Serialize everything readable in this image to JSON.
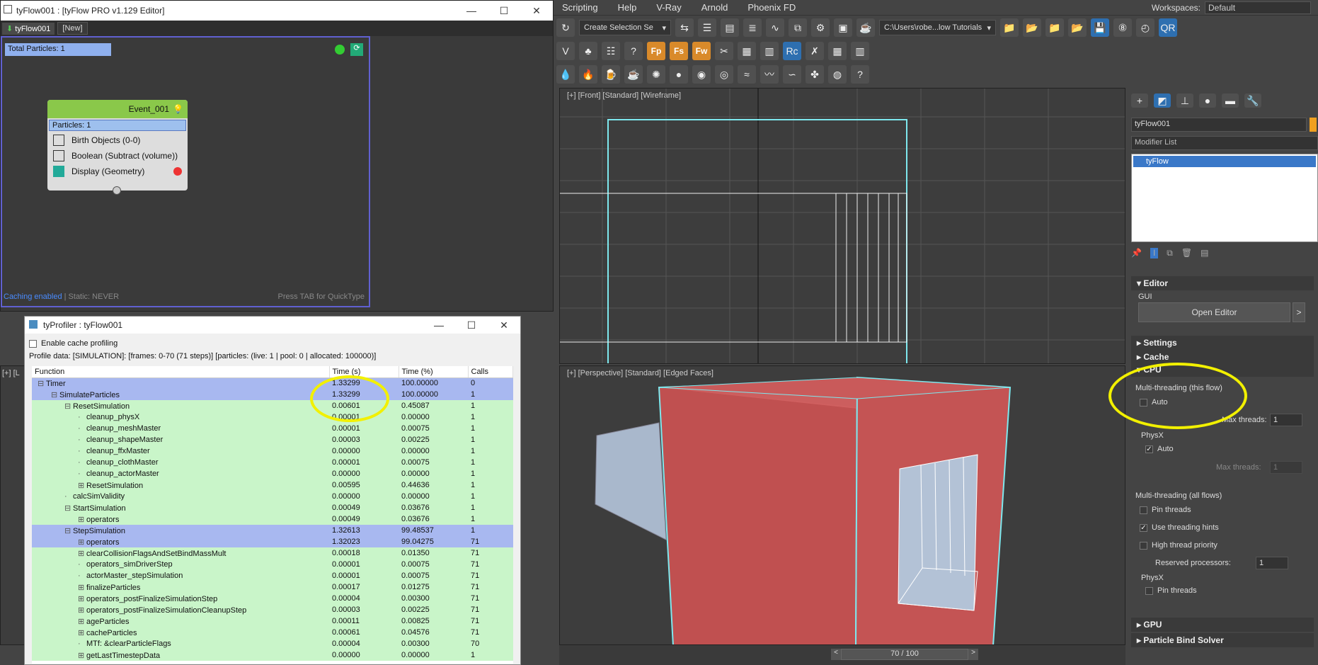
{
  "max": {
    "menu": [
      "Scripting",
      "Help",
      "V-Ray",
      "Arnold",
      "Phoenix FD"
    ],
    "workspaces_label": "Workspaces:",
    "workspace": "Default",
    "selection_set": "Create Selection Se",
    "path": "C:\\Users\\robe...low Tutorials",
    "toolbar2_icons": [
      "Fp",
      "Fs",
      "Fw",
      "Rc"
    ],
    "frame": "70 / 100"
  },
  "viewports": {
    "front": "[+] [Front] [Standard] [Wireframe]",
    "persp": "[+] [Perspective] [Standard] [Edged Faces]",
    "left_label": "[+] [L"
  },
  "cmd": {
    "object_name": "tyFlow001",
    "modifier_list": "Modifier List",
    "stack_item": "tyFlow",
    "editor": "Editor",
    "gui": "GUI",
    "open_editor": "Open Editor",
    "arrow": ">",
    "settings": "Settings",
    "cache": "Cache",
    "cpu": "CPU",
    "mt_this": "Multi-threading (this flow)",
    "auto": "Auto",
    "max_threads": "Max threads:",
    "max_threads_val": "1",
    "physx": "PhysX",
    "physx_auto": "Auto",
    "physx_max": "Max threads:",
    "physx_max_val": "1",
    "mt_all": "Multi-threading (all flows)",
    "pin": "Pin threads",
    "hints": "Use threading hints",
    "priority": "High thread priority",
    "reserved": "Reserved processors:",
    "reserved_val": "1",
    "physx2": "PhysX",
    "pin2": "Pin threads",
    "gpu": "GPU",
    "pbs": "Particle Bind Solver"
  },
  "ty": {
    "title": "tyFlow001 : [tyFlow PRO v1.129 Editor]",
    "tab1": "tyFlow001",
    "tab2": "[New]",
    "total": "Total Particles: 1",
    "event": "Event_001",
    "particles": "Particles: 1",
    "ops": [
      "Birth Objects (0-0)",
      "Boolean (Subtract (volume))",
      "Display (Geometry)"
    ],
    "status": "Caching enabled",
    "static": " | Static: NEVER",
    "hint": "Press TAB for QuickType"
  },
  "prof": {
    "title": "tyProfiler : tyFlow001",
    "cache": "Enable cache profiling",
    "data": "Profile data:   [SIMULATION]: [frames: 0-70 (71 steps)] [particles: (live: 1 | pool: 0 | allocated: 100000)]",
    "cols": [
      "Function",
      "Time (s)",
      "Time (%)",
      "Calls"
    ],
    "rows": [
      {
        "f": "Timer",
        "t": "1.33299",
        "p": "100.00000",
        "c": "0",
        "ind": 0,
        "st": "s",
        "ex": "-"
      },
      {
        "f": "SimulateParticles",
        "t": "1.33299",
        "p": "100.00000",
        "c": "1",
        "ind": 1,
        "st": "s",
        "ex": "-"
      },
      {
        "f": "ResetSimulation",
        "t": "0.00601",
        "p": "0.45087",
        "c": "1",
        "ind": 2,
        "st": "g",
        "ex": "-"
      },
      {
        "f": "cleanup_physX",
        "t": "0.00001",
        "p": "0.00000",
        "c": "1",
        "ind": 3,
        "st": "g",
        "ex": ""
      },
      {
        "f": "cleanup_meshMaster",
        "t": "0.00001",
        "p": "0.00075",
        "c": "1",
        "ind": 3,
        "st": "g",
        "ex": ""
      },
      {
        "f": "cleanup_shapeMaster",
        "t": "0.00003",
        "p": "0.00225",
        "c": "1",
        "ind": 3,
        "st": "g",
        "ex": ""
      },
      {
        "f": "cleanup_ffxMaster",
        "t": "0.00000",
        "p": "0.00000",
        "c": "1",
        "ind": 3,
        "st": "g",
        "ex": ""
      },
      {
        "f": "cleanup_clothMaster",
        "t": "0.00001",
        "p": "0.00075",
        "c": "1",
        "ind": 3,
        "st": "g",
        "ex": ""
      },
      {
        "f": "cleanup_actorMaster",
        "t": "0.00000",
        "p": "0.00000",
        "c": "1",
        "ind": 3,
        "st": "g",
        "ex": ""
      },
      {
        "f": "ResetSimulation",
        "t": "0.00595",
        "p": "0.44636",
        "c": "1",
        "ind": 3,
        "st": "g",
        "ex": "+"
      },
      {
        "f": "calcSimValidity",
        "t": "0.00000",
        "p": "0.00000",
        "c": "1",
        "ind": 2,
        "st": "g",
        "ex": ""
      },
      {
        "f": "StartSimulation",
        "t": "0.00049",
        "p": "0.03676",
        "c": "1",
        "ind": 2,
        "st": "g",
        "ex": "-"
      },
      {
        "f": "operators",
        "t": "0.00049",
        "p": "0.03676",
        "c": "1",
        "ind": 3,
        "st": "g",
        "ex": "+"
      },
      {
        "f": "StepSimulation",
        "t": "1.32613",
        "p": "99.48537",
        "c": "1",
        "ind": 2,
        "st": "s",
        "ex": "-"
      },
      {
        "f": "operators",
        "t": "1.32023",
        "p": "99.04275",
        "c": "71",
        "ind": 3,
        "st": "s",
        "ex": "+"
      },
      {
        "f": "clearCollisionFlagsAndSetBindMassMult",
        "t": "0.00018",
        "p": "0.01350",
        "c": "71",
        "ind": 3,
        "st": "g",
        "ex": "+"
      },
      {
        "f": "operators_simDriverStep",
        "t": "0.00001",
        "p": "0.00075",
        "c": "71",
        "ind": 3,
        "st": "g",
        "ex": ""
      },
      {
        "f": "actorMaster_stepSimulation",
        "t": "0.00001",
        "p": "0.00075",
        "c": "71",
        "ind": 3,
        "st": "g",
        "ex": ""
      },
      {
        "f": "finalizeParticles",
        "t": "0.00017",
        "p": "0.01275",
        "c": "71",
        "ind": 3,
        "st": "g",
        "ex": "+"
      },
      {
        "f": "operators_postFinalizeSimulationStep",
        "t": "0.00004",
        "p": "0.00300",
        "c": "71",
        "ind": 3,
        "st": "g",
        "ex": "+"
      },
      {
        "f": "operators_postFinalizeSimulationCleanupStep",
        "t": "0.00003",
        "p": "0.00225",
        "c": "71",
        "ind": 3,
        "st": "g",
        "ex": "+"
      },
      {
        "f": "ageParticles",
        "t": "0.00011",
        "p": "0.00825",
        "c": "71",
        "ind": 3,
        "st": "g",
        "ex": "+"
      },
      {
        "f": "cacheParticles",
        "t": "0.00061",
        "p": "0.04576",
        "c": "71",
        "ind": 3,
        "st": "g",
        "ex": "+"
      },
      {
        "f": "MTf: &clearParticleFlags",
        "t": "0.00004",
        "p": "0.00300",
        "c": "70",
        "ind": 3,
        "st": "g",
        "ex": ""
      },
      {
        "f": "getLastTimestepData",
        "t": "0.00000",
        "p": "0.00000",
        "c": "1",
        "ind": 3,
        "st": "g",
        "ex": "+"
      }
    ]
  }
}
